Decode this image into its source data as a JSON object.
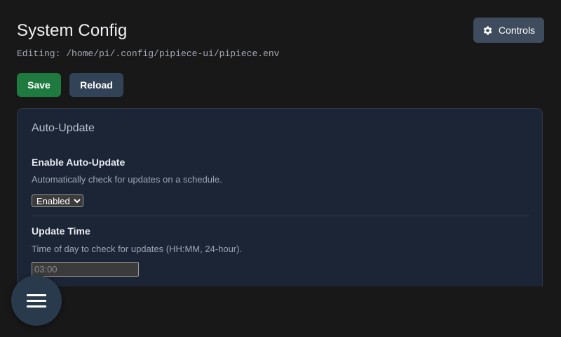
{
  "header": {
    "title": "System Config",
    "editing_path": "Editing: /home/pi/.config/pipiece-ui/pipiece.env",
    "controls_label": "Controls",
    "controls_icon": "gear-icon"
  },
  "toolbar": {
    "save_label": "Save",
    "reload_label": "Reload",
    "save_color": "#1e7a3e",
    "reload_color": "#334357"
  },
  "section": {
    "title": "Auto-Update",
    "settings": [
      {
        "label": "Enable Auto-Update",
        "description": "Automatically check for updates on a schedule.",
        "control": "select",
        "value": "Enabled"
      },
      {
        "label": "Update Time",
        "description": "Time of day to check for updates (HH:MM, 24-hour).",
        "control": "text",
        "value": "",
        "placeholder": "03:00"
      }
    ]
  },
  "fab": {
    "icon": "hamburger-menu-icon"
  }
}
